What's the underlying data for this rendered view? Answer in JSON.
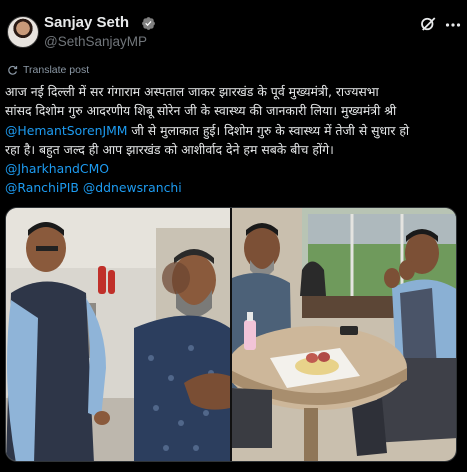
{
  "author": {
    "name": "Sanjay Seth",
    "handle": "@SethSanjayMP",
    "verified": true
  },
  "icons": {
    "verified": "verified-badge-icon",
    "grok": "grok-icon",
    "more": "more-options-icon",
    "translate": "translate-icon"
  },
  "colors": {
    "link": "#1d9bf0",
    "text": "#e7e9ea",
    "muted": "#71767b",
    "verified_badge": "#808080"
  },
  "translate_label": "Translate post",
  "tweet": {
    "line1": "आज नई दिल्ली में सर गंगाराम अस्पताल जाकर झारखंड के पूर्व मुख्यमंत्री, राज्यसभा",
    "line2": "सांसद दिशोम गुरु आदरणीय शिबू सोरेन जी के स्वास्थ्य की जानकारी लिया। मुख्यमंत्री श्री",
    "line3_mention": "@HemantSorenJMM",
    "line3_text": " जी से मुलाकात हुई। दिशोम गुरु के स्वास्थ्य में तेजी से सुधार हो",
    "line4": "रहा है। बहुत जल्द ही आप झारखंड को आशीर्वाद देने हम सबके बीच होंगे।",
    "mention2": "@JharkhandCMO",
    "mention3": "@RanchiPIB",
    "mention4": "@ddnewsranchi"
  },
  "media": {
    "photos": [
      "photo-hospital-corridor-meeting",
      "photo-hospital-room-meeting"
    ]
  }
}
